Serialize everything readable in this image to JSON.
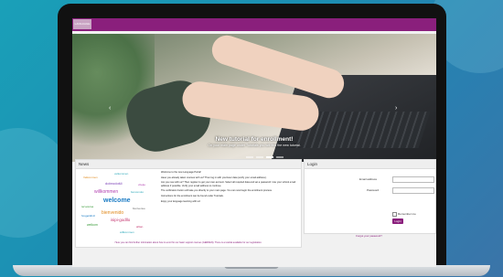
{
  "app": {
    "logo_text": "LANGUAGE PORTAL",
    "brand_color": "#8a1f7c"
  },
  "hero": {
    "title": "New tutorial for enrollment!",
    "subtitle": "On your main page under Tutorials you will find the new tutorial.",
    "prev_icon": "chevron-left-icon",
    "next_icon": "chevron-right-icon",
    "slides": 4,
    "active_slide": 3
  },
  "news": {
    "heading": "News",
    "cloud_words": [
      {
        "text": "welcome",
        "color": "#1a7bc4"
      },
      {
        "text": "velkommen",
        "color": "#2ba7b8"
      },
      {
        "text": "willkommen",
        "color": "#b13fb0"
      },
      {
        "text": "bienvenido",
        "color": "#e08a1e"
      },
      {
        "text": "dobrodošli",
        "color": "#7a3fb5"
      },
      {
        "text": "isipi-godllo",
        "color": "#c22f6a"
      },
      {
        "text": "tervetuloa",
        "color": "#3a9b3a"
      },
      {
        "text": "benvenuto",
        "color": "#2ba7b8"
      },
      {
        "text": "bienvenue",
        "color": "#6a6a6a"
      },
      {
        "text": "Velkommen",
        "color": "#e08a1e"
      },
      {
        "text": "welkom",
        "color": "#3a9b3a"
      },
      {
        "text": "vítejte",
        "color": "#b13fb0"
      },
      {
        "text": "hoşgeldiniz",
        "color": "#1a7bc4"
      },
      {
        "text": "ahlan",
        "color": "#c22f6a"
      },
      {
        "text": "willkommen",
        "color": "#2ba7b8"
      }
    ],
    "paragraphs": [
      "Welcome to the new Language Portal!",
      "Have you already taken courses with us? Then log in with your/user data (verify your email address).",
      "Are you new with us? Then register to get your own account. Select all required data and set a password. Use your school email address if possible. Verify your email address to continue.",
      "The verification button will take you directly to your main page. You can now begin the enrollment process.",
      "Instructions for the enrollment can be found under Tutorials.",
      "Enjoy your language learning with us!"
    ],
    "footer": "Here you can find further information about how to enrol for our basic support courses (GERDEN). There is a tutorial available for our registration."
  },
  "login": {
    "heading": "Login",
    "email_label": "Email address",
    "email_value": "",
    "password_label": "Password",
    "password_value": "",
    "remember_label": "Remember me",
    "remember_checked": false,
    "submit_label": "Login",
    "forgot_label": "Forgot your password?"
  }
}
